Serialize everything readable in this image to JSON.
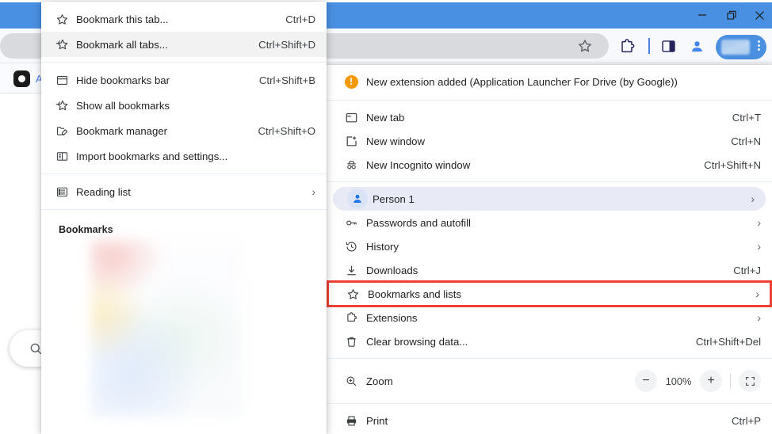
{
  "window": {
    "titlebar_color": "#4a90e2",
    "controls": [
      {
        "name": "minimize",
        "glyph": "—"
      },
      {
        "name": "restore",
        "glyph": "❐"
      },
      {
        "name": "close",
        "glyph": "✕"
      }
    ]
  },
  "toolbar": {
    "omnibox_value": "",
    "omnibox_placeholder": "",
    "bookmark_star_title": "Bookmark this tab",
    "extensions_title": "Extensions",
    "side_panel_title": "Side panel",
    "profile_title": "Profile",
    "avatar_menu_dots": "⋮"
  },
  "background_page": {
    "tab_label": "All",
    "search_fab_icon": "search-icon"
  },
  "submenu": {
    "title": "Bookmarks and lists",
    "groups": [
      {
        "items": [
          {
            "icon": "star-outline-icon",
            "label": "Bookmark this tab...",
            "accelerator": "Ctrl+D",
            "hover": false,
            "chevron": false
          },
          {
            "icon": "star-all-tabs-icon",
            "label": "Bookmark all tabs...",
            "accelerator": "Ctrl+Shift+D",
            "hover": true,
            "chevron": false
          }
        ]
      },
      {
        "items": [
          {
            "icon": "bookmarks-bar-icon",
            "label": "Hide bookmarks bar",
            "accelerator": "Ctrl+Shift+B",
            "hover": false,
            "chevron": false
          },
          {
            "icon": "star-all-tabs-icon",
            "label": "Show all bookmarks",
            "accelerator": "",
            "hover": false,
            "chevron": false
          },
          {
            "icon": "bookmark-manager-icon",
            "label": "Bookmark manager",
            "accelerator": "Ctrl+Shift+O",
            "hover": false,
            "chevron": false
          },
          {
            "icon": "import-bookmarks-icon",
            "label": "Import bookmarks and settings...",
            "accelerator": "",
            "hover": false,
            "chevron": false
          }
        ]
      },
      {
        "items": [
          {
            "icon": "reading-list-icon",
            "label": "Reading list",
            "accelerator": "",
            "hover": false,
            "chevron": true
          }
        ]
      }
    ],
    "section_header": "Bookmarks",
    "blurred_content": true
  },
  "main_menu": {
    "notice": {
      "icon": "warning-icon",
      "text": "New extension added (Application Launcher For Drive (by Google))"
    },
    "groups": [
      {
        "items": [
          {
            "icon": "new-tab-icon",
            "label": "New tab",
            "accelerator": "Ctrl+T",
            "chevron": false,
            "style": "plain"
          },
          {
            "icon": "new-window-icon",
            "label": "New window",
            "accelerator": "Ctrl+N",
            "chevron": false,
            "style": "plain"
          },
          {
            "icon": "incognito-icon",
            "label": "New Incognito window",
            "accelerator": "Ctrl+Shift+N",
            "chevron": false,
            "style": "plain"
          }
        ]
      },
      {
        "items": [
          {
            "icon": "person-icon",
            "label": "Person 1",
            "accelerator": "",
            "chevron": true,
            "style": "selected"
          },
          {
            "icon": "key-icon",
            "label": "Passwords and autofill",
            "accelerator": "",
            "chevron": true,
            "style": "plain"
          },
          {
            "icon": "history-icon",
            "label": "History",
            "accelerator": "",
            "chevron": true,
            "style": "plain"
          },
          {
            "icon": "download-icon",
            "label": "Downloads",
            "accelerator": "Ctrl+J",
            "chevron": false,
            "style": "plain"
          },
          {
            "icon": "star-outline-icon",
            "label": "Bookmarks and lists",
            "accelerator": "",
            "chevron": true,
            "style": "redbox"
          },
          {
            "icon": "extensions-icon",
            "label": "Extensions",
            "accelerator": "",
            "chevron": true,
            "style": "plain"
          },
          {
            "icon": "trash-icon",
            "label": "Clear browsing data...",
            "accelerator": "Ctrl+Shift+Del",
            "chevron": false,
            "style": "plain"
          }
        ]
      }
    ],
    "zoom": {
      "icon": "zoom-icon",
      "label": "Zoom",
      "minus_label": "−",
      "value": "100%",
      "plus_label": "+",
      "fullscreen_label": "fullscreen-icon"
    },
    "bottom_item": {
      "icon": "print-icon",
      "label": "Print",
      "accelerator": "Ctrl+P"
    },
    "highlight_color": "#ef4034"
  }
}
